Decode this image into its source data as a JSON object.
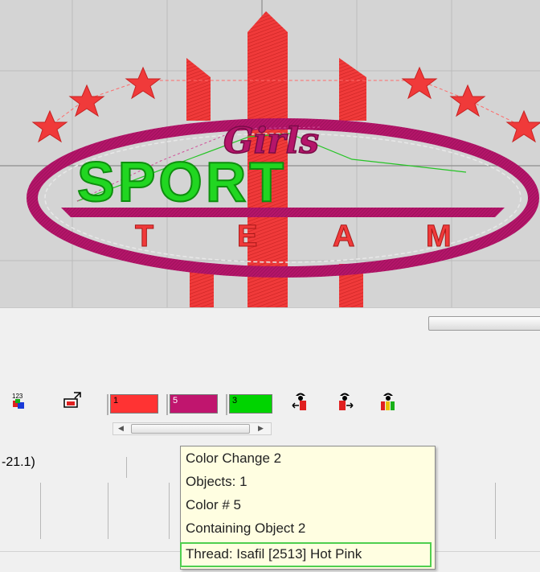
{
  "design": {
    "top_text": "Girls",
    "middle_text": "SPORT",
    "bottom_letters": [
      "T",
      "E",
      "A",
      "M"
    ],
    "colors": {
      "red": "#f03a3a",
      "magenta": "#b5156a",
      "green": "#21d621",
      "canvas": "#d4d4d4",
      "grid": "#bcbcbc"
    }
  },
  "toolbar": {
    "icons": [
      "sequence-123-icon",
      "fit-window-icon",
      "move-back-icon",
      "move-forward-icon",
      "color-sequence-icon"
    ],
    "swatches": [
      {
        "number": "1",
        "color": "#ff3333"
      },
      {
        "number": "5",
        "color": "#c0156e"
      },
      {
        "number": "3",
        "color": "#00d400"
      }
    ]
  },
  "status": {
    "coordinate": "-21.1)"
  },
  "tooltip": {
    "lines": [
      "Color Change 2",
      "Objects: 1",
      "Color # 5",
      "Containing Object 2"
    ],
    "thread": "Thread: Isafil [2513] Hot Pink"
  }
}
